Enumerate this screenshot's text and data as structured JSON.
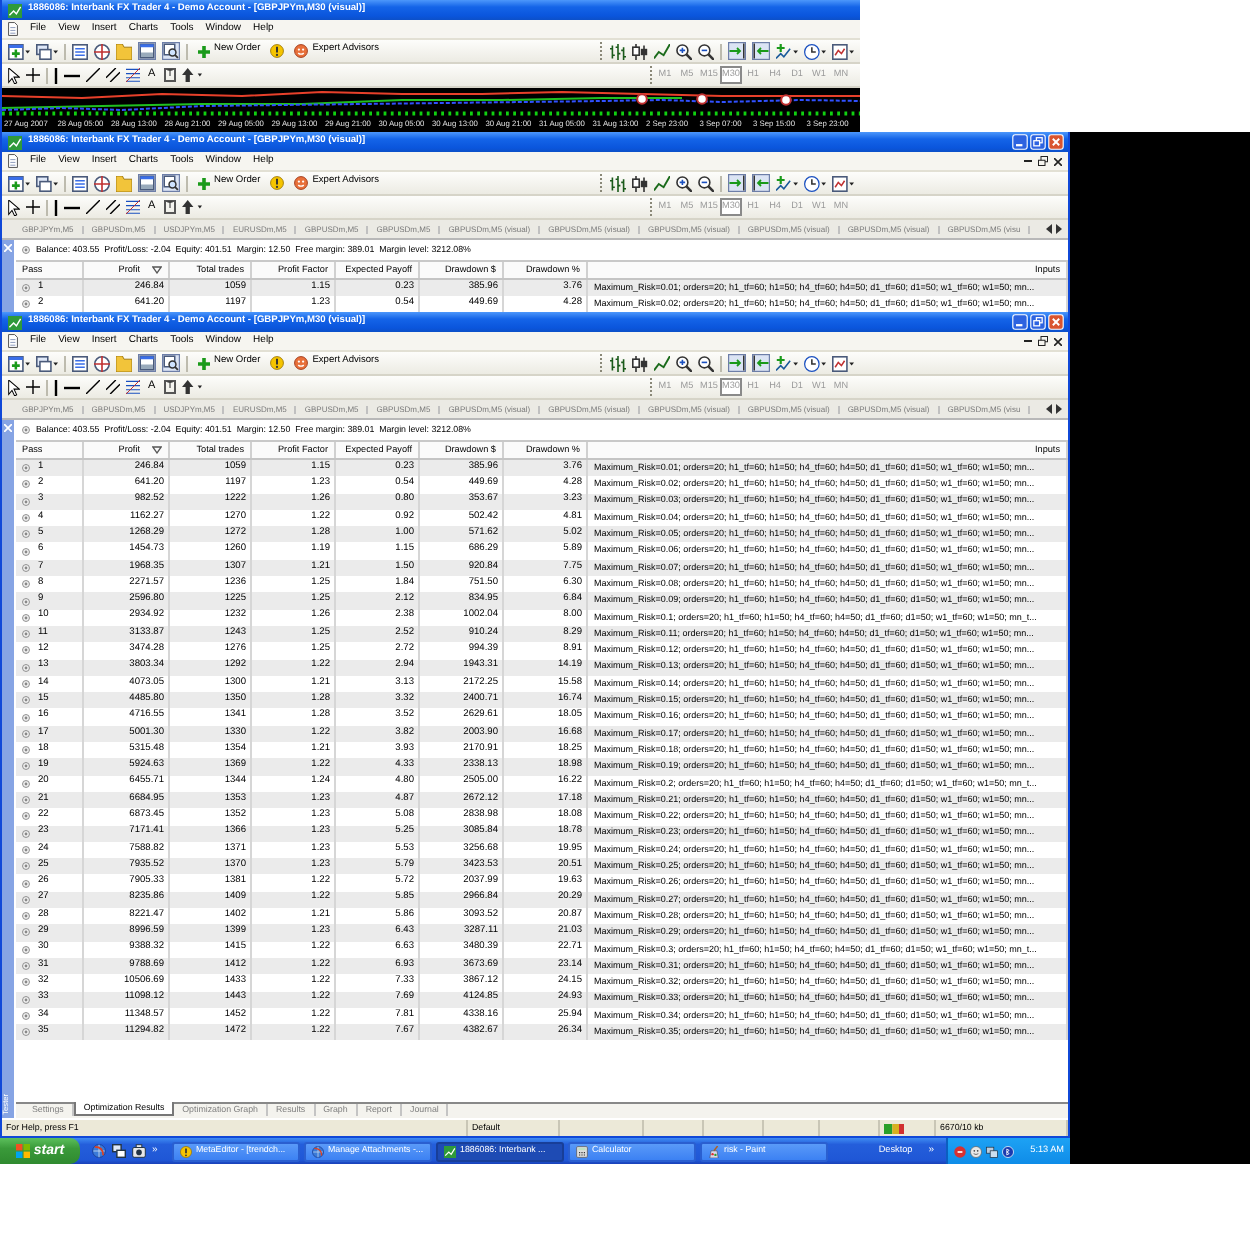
{
  "windows": [
    {
      "kind": "chart",
      "controls": false,
      "title": "1886086: Interbank FX Trader 4 - Demo Account - [GBPJPYm,M30 (visual)]",
      "menu": [
        "File",
        "View",
        "Insert",
        "Charts",
        "Tools",
        "Window",
        "Help"
      ],
      "toolbar": {
        "new_order": "New Order",
        "expert_advisors": "Expert Advisors",
        "text_tool": "A",
        "label_tool": "T",
        "terminal_on": true,
        "tester_on": true,
        "auto_scroll_on": true,
        "chart_shift_on": true
      },
      "timeframes": {
        "disabled": true,
        "items": [
          {
            "label": "M1",
            "selected": false
          },
          {
            "label": "M5",
            "selected": false
          },
          {
            "label": "M15",
            "selected": false
          },
          {
            "label": "M30",
            "selected": true
          },
          {
            "label": "H1",
            "selected": false
          },
          {
            "label": "H4",
            "selected": false
          },
          {
            "label": "D1",
            "selected": false
          },
          {
            "label": "W1",
            "selected": false
          },
          {
            "label": "MN",
            "selected": false
          }
        ]
      },
      "time_axis": [
        "27 Aug 2007",
        "28 Aug 05:00",
        "28 Aug 13:00",
        "28 Aug 21:00",
        "29 Aug 05:00",
        "29 Aug 13:00",
        "29 Aug 21:00",
        "30 Aug 05:00",
        "30 Aug 13:00",
        "30 Aug 21:00",
        "31 Aug 05:00",
        "31 Aug 13:00",
        "2 Sep 23:00",
        "3 Sep 07:00",
        "3 Sep 15:00",
        "3 Sep 23:00"
      ]
    },
    {
      "kind": "tester",
      "controls": true,
      "title": "1886086: Interbank FX Trader 4 - Demo Account - [GBPJPYm,M30 (visual)]",
      "menu": [
        "File",
        "View",
        "Insert",
        "Charts",
        "Tools",
        "Window",
        "Help"
      ],
      "toolbar": {
        "new_order": "New Order",
        "expert_advisors": "Expert Advisors",
        "text_tool": "A",
        "label_tool": "T",
        "terminal_on": true,
        "tester_on": true,
        "auto_scroll_on": true,
        "chart_shift_on": true
      },
      "timeframes": {
        "disabled": true,
        "items": [
          {
            "label": "M1",
            "selected": false
          },
          {
            "label": "M5",
            "selected": false
          },
          {
            "label": "M15",
            "selected": false
          },
          {
            "label": "M30",
            "selected": true
          },
          {
            "label": "H1",
            "selected": false
          },
          {
            "label": "H4",
            "selected": false
          },
          {
            "label": "D1",
            "selected": false
          },
          {
            "label": "W1",
            "selected": false
          },
          {
            "label": "MN",
            "selected": false
          }
        ]
      },
      "chart_tabs": [
        "GBPJPYm,M5",
        "GBPUSDm,M5",
        "USDJPYm,M5",
        "EURUSDm,M5",
        "GBPUSDm,M5",
        "GBPUSDm,M5",
        "GBPUSDm,M5 (visual)",
        "GBPUSDm,M5 (visual)",
        "GBPUSDm,M5 (visual)",
        "GBPUSDm,M5 (visual)",
        "GBPUSDm,M5 (visual)",
        "GBPUSDm,M5 (visu"
      ],
      "account": "Balance: 403.55  Profit/Loss: -2.04  Equity: 401.51  Margin: 12.50  Free margin: 389.01  Margin level: 3212.08%",
      "columns": [
        {
          "label": "Pass",
          "sorted": false
        },
        {
          "label": "Profit",
          "sorted": true
        },
        {
          "label": "Total trades",
          "sorted": false
        },
        {
          "label": "Profit Factor",
          "sorted": false
        },
        {
          "label": "Expected Payoff",
          "sorted": false
        },
        {
          "label": "Drawdown $",
          "sorted": false
        },
        {
          "label": "Drawdown %",
          "sorted": false
        },
        {
          "label": "Inputs",
          "sorted": false
        }
      ],
      "rows": [
        [
          "1",
          "246.84",
          "1059",
          "1.15",
          "0.23",
          "385.96",
          "3.76",
          "Maximum_Risk=0.01; orders=20; h1_tf=60; h1=50; h4_tf=60; h4=50; d1_tf=60; d1=50; w1_tf=60; w1=50; mn..."
        ],
        [
          "2",
          "641.20",
          "1197",
          "1.23",
          "0.54",
          "449.69",
          "4.28",
          "Maximum_Risk=0.02; orders=20; h1_tf=60; h1=50; h4_tf=60; h4=50; d1_tf=60; d1=50; w1_tf=60; w1=50; mn..."
        ]
      ]
    },
    {
      "kind": "tester",
      "controls": true,
      "title": "1886086: Interbank FX Trader 4 - Demo Account - [GBPJPYm,M30 (visual)]",
      "menu": [
        "File",
        "View",
        "Insert",
        "Charts",
        "Tools",
        "Window",
        "Help"
      ],
      "toolbar": {
        "new_order": "New Order",
        "expert_advisors": "Expert Advisors",
        "text_tool": "A",
        "label_tool": "T",
        "terminal_on": true,
        "tester_on": true,
        "auto_scroll_on": true,
        "chart_shift_on": true
      },
      "timeframes": {
        "disabled": true,
        "items": [
          {
            "label": "M1",
            "selected": false
          },
          {
            "label": "M5",
            "selected": false
          },
          {
            "label": "M15",
            "selected": false
          },
          {
            "label": "M30",
            "selected": true
          },
          {
            "label": "H1",
            "selected": false
          },
          {
            "label": "H4",
            "selected": false
          },
          {
            "label": "D1",
            "selected": false
          },
          {
            "label": "W1",
            "selected": false
          },
          {
            "label": "MN",
            "selected": false
          }
        ]
      },
      "chart_tabs": [
        "GBPJPYm,M5",
        "GBPUSDm,M5",
        "USDJPYm,M5",
        "EURUSDm,M5",
        "GBPUSDm,M5",
        "GBPUSDm,M5",
        "GBPUSDm,M5 (visual)",
        "GBPUSDm,M5 (visual)",
        "GBPUSDm,M5 (visual)",
        "GBPUSDm,M5 (visual)",
        "GBPUSDm,M5 (visual)",
        "GBPUSDm,M5 (visu"
      ],
      "account": "Balance: 403.55  Profit/Loss: -2.04  Equity: 401.51  Margin: 12.50  Free margin: 389.01  Margin level: 3212.08%",
      "columns": [
        {
          "label": "Pass",
          "sorted": false
        },
        {
          "label": "Profit",
          "sorted": true
        },
        {
          "label": "Total trades",
          "sorted": false
        },
        {
          "label": "Profit Factor",
          "sorted": false
        },
        {
          "label": "Expected Payoff",
          "sorted": false
        },
        {
          "label": "Drawdown $",
          "sorted": false
        },
        {
          "label": "Drawdown %",
          "sorted": false
        },
        {
          "label": "Inputs",
          "sorted": false
        }
      ],
      "rows": [
        [
          "1",
          "246.84",
          "1059",
          "1.15",
          "0.23",
          "385.96",
          "3.76",
          "Maximum_Risk=0.01; orders=20; h1_tf=60; h1=50; h4_tf=60; h4=50; d1_tf=60; d1=50; w1_tf=60; w1=50; mn..."
        ],
        [
          "2",
          "641.20",
          "1197",
          "1.23",
          "0.54",
          "449.69",
          "4.28",
          "Maximum_Risk=0.02; orders=20; h1_tf=60; h1=50; h4_tf=60; h4=50; d1_tf=60; d1=50; w1_tf=60; w1=50; mn..."
        ],
        [
          "3",
          "982.52",
          "1222",
          "1.26",
          "0.80",
          "353.67",
          "3.23",
          "Maximum_Risk=0.03; orders=20; h1_tf=60; h1=50; h4_tf=60; h4=50; d1_tf=60; d1=50; w1_tf=60; w1=50; mn..."
        ],
        [
          "4",
          "1162.27",
          "1270",
          "1.22",
          "0.92",
          "502.42",
          "4.81",
          "Maximum_Risk=0.04; orders=20; h1_tf=60; h1=50; h4_tf=60; h4=50; d1_tf=60; d1=50; w1_tf=60; w1=50; mn..."
        ],
        [
          "5",
          "1268.29",
          "1272",
          "1.28",
          "1.00",
          "571.62",
          "5.02",
          "Maximum_Risk=0.05; orders=20; h1_tf=60; h1=50; h4_tf=60; h4=50; d1_tf=60; d1=50; w1_tf=60; w1=50; mn..."
        ],
        [
          "6",
          "1454.73",
          "1260",
          "1.19",
          "1.15",
          "686.29",
          "5.89",
          "Maximum_Risk=0.06; orders=20; h1_tf=60; h1=50; h4_tf=60; h4=50; d1_tf=60; d1=50; w1_tf=60; w1=50; mn..."
        ],
        [
          "7",
          "1968.35",
          "1307",
          "1.21",
          "1.50",
          "920.84",
          "7.75",
          "Maximum_Risk=0.07; orders=20; h1_tf=60; h1=50; h4_tf=60; h4=50; d1_tf=60; d1=50; w1_tf=60; w1=50; mn..."
        ],
        [
          "8",
          "2271.57",
          "1236",
          "1.25",
          "1.84",
          "751.50",
          "6.30",
          "Maximum_Risk=0.08; orders=20; h1_tf=60; h1=50; h4_tf=60; h4=50; d1_tf=60; d1=50; w1_tf=60; w1=50; mn..."
        ],
        [
          "9",
          "2596.80",
          "1225",
          "1.25",
          "2.12",
          "834.95",
          "6.84",
          "Maximum_Risk=0.09; orders=20; h1_tf=60; h1=50; h4_tf=60; h4=50; d1_tf=60; d1=50; w1_tf=60; w1=50; mn..."
        ],
        [
          "10",
          "2934.92",
          "1232",
          "1.26",
          "2.38",
          "1002.04",
          "8.00",
          "Maximum_Risk=0.1; orders=20; h1_tf=60; h1=50; h4_tf=60; h4=50; d1_tf=60; d1=50; w1_tf=60; w1=50; mn_t..."
        ],
        [
          "11",
          "3133.87",
          "1243",
          "1.25",
          "2.52",
          "910.24",
          "8.29",
          "Maximum_Risk=0.11; orders=20; h1_tf=60; h1=50; h4_tf=60; h4=50; d1_tf=60; d1=50; w1_tf=60; w1=50; mn..."
        ],
        [
          "12",
          "3474.28",
          "1276",
          "1.25",
          "2.72",
          "994.39",
          "8.91",
          "Maximum_Risk=0.12; orders=20; h1_tf=60; h1=50; h4_tf=60; h4=50; d1_tf=60; d1=50; w1_tf=60; w1=50; mn..."
        ],
        [
          "13",
          "3803.34",
          "1292",
          "1.22",
          "2.94",
          "1943.31",
          "14.19",
          "Maximum_Risk=0.13; orders=20; h1_tf=60; h1=50; h4_tf=60; h4=50; d1_tf=60; d1=50; w1_tf=60; w1=50; mn..."
        ],
        [
          "14",
          "4073.05",
          "1300",
          "1.21",
          "3.13",
          "2172.25",
          "15.58",
          "Maximum_Risk=0.14; orders=20; h1_tf=60; h1=50; h4_tf=60; h4=50; d1_tf=60; d1=50; w1_tf=60; w1=50; mn..."
        ],
        [
          "15",
          "4485.80",
          "1350",
          "1.28",
          "3.32",
          "2400.71",
          "16.74",
          "Maximum_Risk=0.15; orders=20; h1_tf=60; h1=50; h4_tf=60; h4=50; d1_tf=60; d1=50; w1_tf=60; w1=50; mn..."
        ],
        [
          "16",
          "4716.55",
          "1341",
          "1.28",
          "3.52",
          "2629.61",
          "18.05",
          "Maximum_Risk=0.16; orders=20; h1_tf=60; h1=50; h4_tf=60; h4=50; d1_tf=60; d1=50; w1_tf=60; w1=50; mn..."
        ],
        [
          "17",
          "5001.30",
          "1330",
          "1.22",
          "3.82",
          "2003.90",
          "16.68",
          "Maximum_Risk=0.17; orders=20; h1_tf=60; h1=50; h4_tf=60; h4=50; d1_tf=60; d1=50; w1_tf=60; w1=50; mn..."
        ],
        [
          "18",
          "5315.48",
          "1354",
          "1.21",
          "3.93",
          "2170.91",
          "18.25",
          "Maximum_Risk=0.18; orders=20; h1_tf=60; h1=50; h4_tf=60; h4=50; d1_tf=60; d1=50; w1_tf=60; w1=50; mn..."
        ],
        [
          "19",
          "5924.63",
          "1369",
          "1.22",
          "4.33",
          "2338.13",
          "18.98",
          "Maximum_Risk=0.19; orders=20; h1_tf=60; h1=50; h4_tf=60; h4=50; d1_tf=60; d1=50; w1_tf=60; w1=50; mn..."
        ],
        [
          "20",
          "6455.71",
          "1344",
          "1.24",
          "4.80",
          "2505.00",
          "16.22",
          "Maximum_Risk=0.2; orders=20; h1_tf=60; h1=50; h4_tf=60; h4=50; d1_tf=60; d1=50; w1_tf=60; w1=50; mn_t..."
        ],
        [
          "21",
          "6684.95",
          "1353",
          "1.23",
          "4.87",
          "2672.12",
          "17.18",
          "Maximum_Risk=0.21; orders=20; h1_tf=60; h1=50; h4_tf=60; h4=50; d1_tf=60; d1=50; w1_tf=60; w1=50; mn..."
        ],
        [
          "22",
          "6873.45",
          "1352",
          "1.23",
          "5.08",
          "2838.98",
          "18.08",
          "Maximum_Risk=0.22; orders=20; h1_tf=60; h1=50; h4_tf=60; h4=50; d1_tf=60; d1=50; w1_tf=60; w1=50; mn..."
        ],
        [
          "23",
          "7171.41",
          "1366",
          "1.23",
          "5.25",
          "3085.84",
          "18.78",
          "Maximum_Risk=0.23; orders=20; h1_tf=60; h1=50; h4_tf=60; h4=50; d1_tf=60; d1=50; w1_tf=60; w1=50; mn..."
        ],
        [
          "24",
          "7588.82",
          "1371",
          "1.23",
          "5.53",
          "3256.68",
          "19.95",
          "Maximum_Risk=0.24; orders=20; h1_tf=60; h1=50; h4_tf=60; h4=50; d1_tf=60; d1=50; w1_tf=60; w1=50; mn..."
        ],
        [
          "25",
          "7935.52",
          "1370",
          "1.23",
          "5.79",
          "3423.53",
          "20.51",
          "Maximum_Risk=0.25; orders=20; h1_tf=60; h1=50; h4_tf=60; h4=50; d1_tf=60; d1=50; w1_tf=60; w1=50; mn..."
        ],
        [
          "26",
          "7905.33",
          "1381",
          "1.22",
          "5.72",
          "2037.99",
          "19.63",
          "Maximum_Risk=0.26; orders=20; h1_tf=60; h1=50; h4_tf=60; h4=50; d1_tf=60; d1=50; w1_tf=60; w1=50; mn..."
        ],
        [
          "27",
          "8235.86",
          "1409",
          "1.22",
          "5.85",
          "2966.84",
          "20.29",
          "Maximum_Risk=0.27; orders=20; h1_tf=60; h1=50; h4_tf=60; h4=50; d1_tf=60; d1=50; w1_tf=60; w1=50; mn..."
        ],
        [
          "28",
          "8221.47",
          "1402",
          "1.21",
          "5.86",
          "3093.52",
          "20.87",
          "Maximum_Risk=0.28; orders=20; h1_tf=60; h1=50; h4_tf=60; h4=50; d1_tf=60; d1=50; w1_tf=60; w1=50; mn..."
        ],
        [
          "29",
          "8996.59",
          "1399",
          "1.23",
          "6.43",
          "3287.11",
          "21.03",
          "Maximum_Risk=0.29; orders=20; h1_tf=60; h1=50; h4_tf=60; h4=50; d1_tf=60; d1=50; w1_tf=60; w1=50; mn..."
        ],
        [
          "30",
          "9388.32",
          "1415",
          "1.22",
          "6.63",
          "3480.39",
          "22.71",
          "Maximum_Risk=0.3; orders=20; h1_tf=60; h1=50; h4_tf=60; h4=50; d1_tf=60; d1=50; w1_tf=60; w1=50; mn_t..."
        ],
        [
          "31",
          "9788.69",
          "1412",
          "1.22",
          "6.93",
          "3673.69",
          "23.14",
          "Maximum_Risk=0.31; orders=20; h1_tf=60; h1=50; h4_tf=60; h4=50; d1_tf=60; d1=50; w1_tf=60; w1=50; mn..."
        ],
        [
          "32",
          "10506.69",
          "1433",
          "1.22",
          "7.33",
          "3867.12",
          "24.15",
          "Maximum_Risk=0.32; orders=20; h1_tf=60; h1=50; h4_tf=60; h4=50; d1_tf=60; d1=50; w1_tf=60; w1=50; mn..."
        ],
        [
          "33",
          "11098.12",
          "1443",
          "1.22",
          "7.69",
          "4124.85",
          "24.93",
          "Maximum_Risk=0.33; orders=20; h1_tf=60; h1=50; h4_tf=60; h4=50; d1_tf=60; d1=50; w1_tf=60; w1=50; mn..."
        ],
        [
          "34",
          "11348.57",
          "1452",
          "1.22",
          "7.81",
          "4338.16",
          "25.94",
          "Maximum_Risk=0.34; orders=20; h1_tf=60; h1=50; h4_tf=60; h4=50; d1_tf=60; d1=50; w1_tf=60; w1=50; mn..."
        ],
        [
          "35",
          "11294.82",
          "1472",
          "1.22",
          "7.67",
          "4382.67",
          "26.34",
          "Maximum_Risk=0.35; orders=20; h1_tf=60; h1=50; h4_tf=60; h4=50; d1_tf=60; d1=50; w1_tf=60; w1=50; mn..."
        ]
      ],
      "panel_title": "Tester",
      "bottom_tabs": [
        {
          "label": "Settings",
          "selected": false
        },
        {
          "label": "Optimization Results",
          "selected": true
        },
        {
          "label": "Optimization Graph",
          "selected": false
        },
        {
          "label": "Results",
          "selected": false
        },
        {
          "label": "Graph",
          "selected": false
        },
        {
          "label": "Report",
          "selected": false
        },
        {
          "label": "Journal",
          "selected": false
        }
      ],
      "status_bar": {
        "help": "For Help, press F1",
        "profile": "Default",
        "traffic": "6670/10 kb"
      }
    }
  ],
  "taskbar": {
    "start": "start",
    "quick_launch_more": "»",
    "tasks": [
      {
        "kind": "editor",
        "label": "MetaEditor - [trendch...",
        "selected": false
      },
      {
        "kind": "browser",
        "label": "Manage Attachments -...",
        "selected": false
      },
      {
        "kind": "terminal",
        "label": "1886086: Interbank ...",
        "selected": true
      },
      {
        "kind": "calculator",
        "label": "Calculator",
        "selected": false
      },
      {
        "kind": "paint",
        "label": "risk - Paint",
        "selected": false
      }
    ],
    "toolbar": "Desktop",
    "toolbar_more": "»",
    "clock": "5:13 AM"
  }
}
